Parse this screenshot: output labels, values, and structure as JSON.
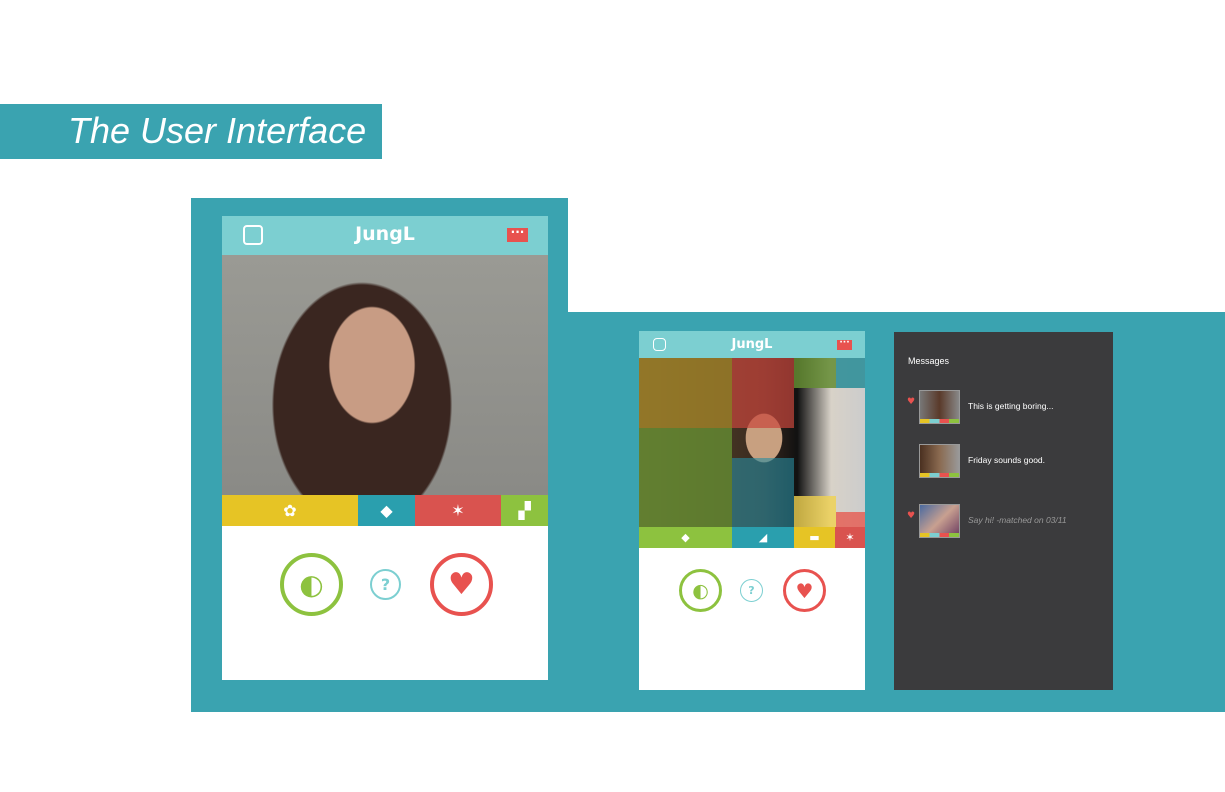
{
  "slide_title": "The User Interface",
  "app": {
    "title": "JungL",
    "profile_icon": "profile-icon",
    "chat_icon": "chat-bubble-icon"
  },
  "colors": {
    "teal": "#3aa3b0",
    "header": "#7ccfd1",
    "yellow": "#e6c425",
    "red": "#e8524f",
    "green": "#8dc23f",
    "dark": "#3b3b3d"
  },
  "phone1": {
    "strip": [
      "octopus-icon",
      "turtle-icon",
      "monkey-icon",
      "dog-icon"
    ],
    "buttons": {
      "reject": "lime-icon",
      "info": "?",
      "like": "strawberry-icon"
    }
  },
  "phone2": {
    "mosaic_icons": [
      "dog-icon",
      "flamingo-icon",
      "crocodile-icon",
      "octopus-icon"
    ],
    "strip": [
      "turtle-icon",
      "dolphin-icon",
      "beaver-icon",
      "monkey-icon"
    ],
    "buttons": {
      "reject": "lime-icon",
      "info": "?",
      "like": "strawberry-icon"
    }
  },
  "messages": {
    "title": "Messages",
    "items": [
      {
        "text": "This is getting boring...",
        "heart": true,
        "italic": false
      },
      {
        "text": "Friday sounds good.",
        "heart": false,
        "italic": false
      },
      {
        "text": "Say hi! -matched on 03/11",
        "heart": true,
        "italic": true
      }
    ]
  }
}
